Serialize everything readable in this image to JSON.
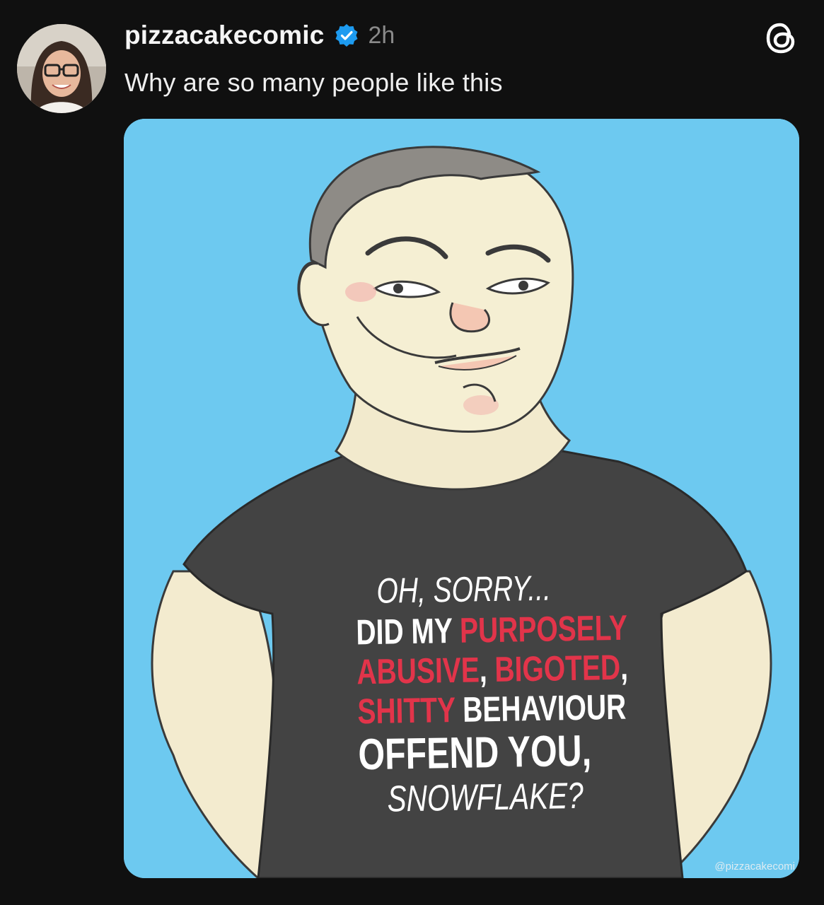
{
  "post": {
    "username": "pizzacakecomic",
    "timestamp": "2h",
    "text": "Why are so many people like this",
    "verified_icon": "verified-badge-icon",
    "app_icon": "threads-logo-icon",
    "accent_color": "#1d9bf0"
  },
  "comic": {
    "background_color": "#6dc9f0",
    "shirt_lines": {
      "line1": "OH, SORRY...",
      "line2_white": "DID MY ",
      "line2_red": "PURPOSELY",
      "line3_red_a": "ABUSIVE",
      "line3_white_a": ", ",
      "line3_red_b": "BIGOTED",
      "line3_white_b": ",",
      "line4_red": "SHITTY",
      "line4_white": " BEHAVIOUR",
      "line5": "OFFEND YOU,",
      "line6": "SNOWFLAKE?"
    },
    "highlight_color": "#e2344a",
    "watermark": "@pizzacakecomi"
  }
}
